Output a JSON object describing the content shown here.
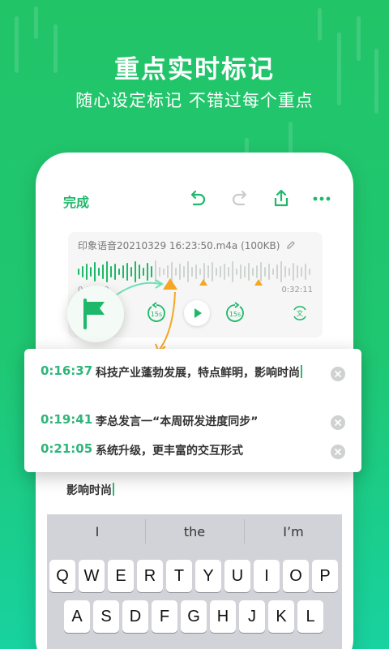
{
  "headline": "重点实时标记",
  "subline": "随心设定标记  不错过每个重点",
  "toolbar": {
    "done_label": "完成",
    "icons": [
      "undo-icon",
      "redo-icon",
      "share-icon",
      "more-icon"
    ]
  },
  "recording": {
    "filename": "印象语音20210329 16:23:50.m4a (100KB)",
    "time_start": "0:00:00",
    "time_end": "0:32:11",
    "rewind_label": "15s",
    "forward_label": "15s"
  },
  "marks": [
    {
      "time": "0:16:37",
      "text": "科技产业蓬勃发展，特点鲜明，影响时尚"
    },
    {
      "time": "0:19:41",
      "text": "李总发言一“本周研发进度同步”"
    },
    {
      "time": "0:21:05",
      "text": "系统升级，更丰富的交互形式"
    }
  ],
  "editor": {
    "text": "影响时尚"
  },
  "keyboard": {
    "suggestions": [
      "I",
      "the",
      "I’m"
    ],
    "row1": [
      "Q",
      "W",
      "E",
      "R",
      "T",
      "Y",
      "U",
      "I",
      "O",
      "P"
    ],
    "row2": [
      "A",
      "S",
      "D",
      "F",
      "G",
      "H",
      "J",
      "K",
      "L"
    ]
  },
  "colors": {
    "accent": "#1fb86a",
    "marker": "#f5a623"
  }
}
